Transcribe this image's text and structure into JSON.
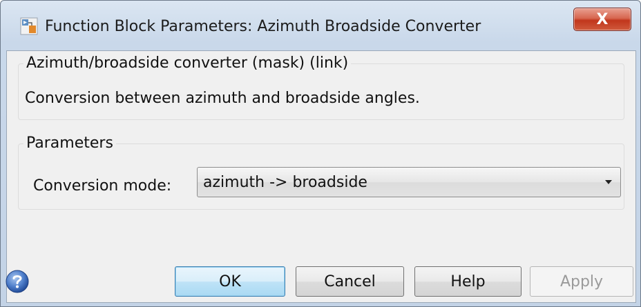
{
  "window": {
    "title": "Function Block Parameters: Azimuth Broadside Converter",
    "close_glyph": "X"
  },
  "mask_group": {
    "legend": "Azimuth/broadside converter (mask) (link)",
    "description": "Conversion between azimuth and broadside angles."
  },
  "parameters_group": {
    "legend": "Parameters",
    "conversion_mode_label": "Conversion mode:",
    "conversion_mode_value": "azimuth -> broadside"
  },
  "buttons": {
    "ok": "OK",
    "cancel": "Cancel",
    "help": "Help",
    "apply": "Apply"
  },
  "icons": {
    "title": "simulink-block-icon",
    "help": "help-question-icon",
    "close": "close-icon"
  },
  "colors": {
    "ok_accent": "#3c7fb1",
    "close_red": "#c1361c"
  }
}
